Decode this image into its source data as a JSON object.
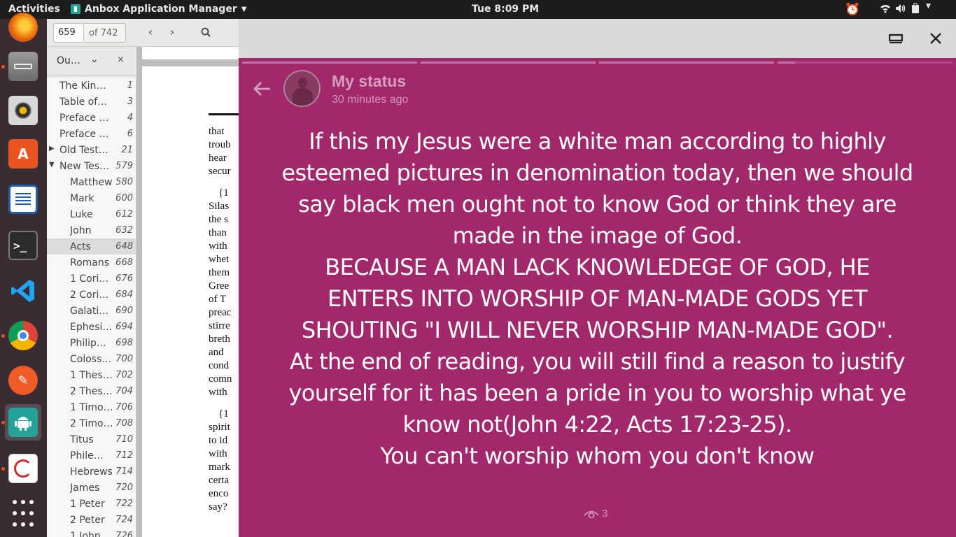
{
  "topbar": {
    "activities": "Activities",
    "app_menu": "Anbox Application Manager",
    "clock": "Tue  8:09 PM"
  },
  "dock": {
    "items": [
      {
        "name": "firefox",
        "color": "#e66000"
      },
      {
        "name": "files",
        "color": "#8a8a8a"
      },
      {
        "name": "rhythmbox",
        "color": "#f2b705"
      },
      {
        "name": "software",
        "color": "#e95420"
      },
      {
        "name": "writer",
        "color": "#1f5fa8"
      },
      {
        "name": "terminal",
        "color": "#2c2c2c"
      },
      {
        "name": "vscode",
        "color": "#22a5f1"
      },
      {
        "name": "chrome",
        "color": "#4285f4"
      },
      {
        "name": "postman",
        "color": "#ef5b25"
      },
      {
        "name": "anbox",
        "color": "#25a39a"
      },
      {
        "name": "evince",
        "color": "#d12b2b"
      },
      {
        "name": "app-grid",
        "color": "#3a2c33"
      }
    ]
  },
  "viewer": {
    "page_value": "659",
    "page_total": "of 742",
    "sidebar_title": "Ou…",
    "outline": [
      {
        "label": "The King …",
        "page": "1",
        "level": 0
      },
      {
        "label": "Table of …",
        "page": "3",
        "level": 0
      },
      {
        "label": "Preface …",
        "page": "4",
        "level": 0
      },
      {
        "label": "Preface …",
        "page": "6",
        "level": 0
      },
      {
        "label": "Old Test…",
        "page": "21",
        "level": 0,
        "toggle": "collapsed"
      },
      {
        "label": "New Tes…",
        "page": "579",
        "level": 0,
        "toggle": "expanded"
      },
      {
        "label": "Matthew",
        "page": "580",
        "level": 1
      },
      {
        "label": "Mark",
        "page": "600",
        "level": 1
      },
      {
        "label": "Luke",
        "page": "612",
        "level": 1
      },
      {
        "label": "John",
        "page": "632",
        "level": 1
      },
      {
        "label": "Acts",
        "page": "648",
        "level": 1,
        "selected": true
      },
      {
        "label": "Romans",
        "page": "668",
        "level": 1
      },
      {
        "label": "1 Cori…",
        "page": "676",
        "level": 1
      },
      {
        "label": "2 Cori…",
        "page": "684",
        "level": 1
      },
      {
        "label": "Galati…",
        "page": "690",
        "level": 1
      },
      {
        "label": "Ephesi…",
        "page": "694",
        "level": 1
      },
      {
        "label": "Philip…",
        "page": "698",
        "level": 1
      },
      {
        "label": "Coloss…",
        "page": "700",
        "level": 1
      },
      {
        "label": "1 Thes…",
        "page": "702",
        "level": 1
      },
      {
        "label": "2 Thes…",
        "page": "704",
        "level": 1
      },
      {
        "label": "1 Timo…",
        "page": "706",
        "level": 1
      },
      {
        "label": "2 Timo…",
        "page": "708",
        "level": 1
      },
      {
        "label": "Titus",
        "page": "710",
        "level": 1
      },
      {
        "label": "Phile…",
        "page": "712",
        "level": 1
      },
      {
        "label": "Hebrews",
        "page": "714",
        "level": 1
      },
      {
        "label": "James",
        "page": "720",
        "level": 1
      },
      {
        "label": "1 Peter",
        "page": "722",
        "level": 1
      },
      {
        "label": "2 Peter",
        "page": "724",
        "level": 1
      },
      {
        "label": "1 John",
        "page": "726",
        "level": 1
      }
    ],
    "page_lines_1": [
      "that",
      "troub",
      "hear",
      "secur"
    ],
    "page_lines_2": [
      "{1",
      "Silas",
      "the s",
      "than",
      "with",
      "whet",
      "them",
      "Gree",
      "of T",
      "preac",
      "stirre",
      "breth",
      "and",
      "cond",
      "comn",
      "with"
    ],
    "page_lines_3": [
      "{1",
      "spirit",
      "to id",
      "with",
      "mark",
      "certa",
      "enco",
      "say?"
    ]
  },
  "anbox": {
    "status_title": "My status",
    "status_time": "30 minutes ago",
    "status_lines": [
      "If this my Jesus were a white man according to highly",
      "esteemed pictures in denomination today, then we should",
      "say black men ought not to know God or think they are",
      "made in the image of God.",
      "BECAUSE A MAN LACK KNOWLEDEGE OF GOD, HE",
      "ENTERS INTO WORSHIP OF MAN-MADE GODS YET",
      "SHOUTING \"I WILL NEVER WORSHIP MAN-MADE GOD\".",
      "At the end of reading, you will still find a reason to justify",
      "yourself for it has been a pride in you to worship what ye",
      "know not(John 4:22, Acts 17:23-25).",
      "You can't worship whom you don't know"
    ],
    "views": "3",
    "background": "#a2286c"
  }
}
